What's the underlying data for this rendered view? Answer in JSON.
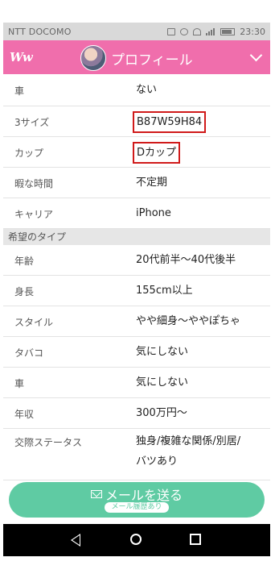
{
  "status_bar": {
    "carrier": "NTT DOCOMO",
    "time": "23:30"
  },
  "header": {
    "logo": "Ww",
    "title": "プロフィール"
  },
  "top_rows": [
    {
      "label": "車",
      "value": "ない"
    },
    {
      "label": "3サイズ",
      "value": "B87W59H84"
    },
    {
      "label": "カップ",
      "value": "Dカップ"
    },
    {
      "label": "暇な時間",
      "value": "不定期"
    },
    {
      "label": "キャリア",
      "value": "iPhone"
    }
  ],
  "section_title": "希望のタイプ",
  "pref_rows": [
    {
      "label": "年齢",
      "value": "20代前半〜40代後半"
    },
    {
      "label": "身長",
      "value": "155cm以上"
    },
    {
      "label": "スタイル",
      "value": "やや細身〜ややぽちゃ"
    },
    {
      "label": "タバコ",
      "value": "気にしない"
    },
    {
      "label": "車",
      "value": "気にしない"
    },
    {
      "label": "年収",
      "value": "300万円〜"
    },
    {
      "label": "交際ステータス",
      "value_line1": "独身/複雑な関係/別居/",
      "value_line2": "バツあり"
    }
  ],
  "mail_button": {
    "label": "メールを送る",
    "badge": "メール履歴あり"
  },
  "colors": {
    "header_bg": "#f06eac",
    "button_bg": "#5fcba3",
    "highlight_border": "#d01a1a"
  }
}
